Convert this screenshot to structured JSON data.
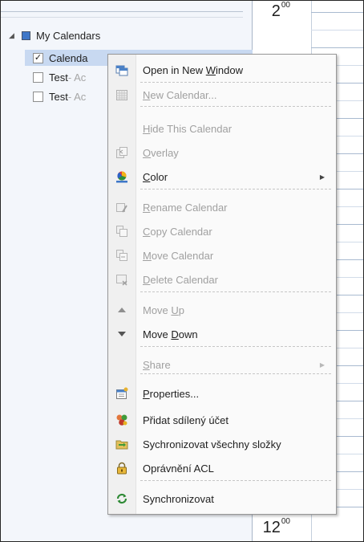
{
  "nav": {
    "group_label": "My Calendars",
    "calendars": [
      {
        "label": "Calenda",
        "suffix": "",
        "checked": true,
        "selected": true
      },
      {
        "label": "Test",
        "suffix": " - Ac",
        "checked": false,
        "selected": false
      },
      {
        "label": "Test",
        "suffix": " - Ac",
        "checked": false,
        "selected": false
      }
    ]
  },
  "dayview": {
    "top_hour": "2",
    "top_minutes": "00",
    "bottom_hour": "12",
    "bottom_minutes": "00"
  },
  "menu": {
    "items": [
      {
        "key": "open_new_window",
        "pre": "Open in New ",
        "ul": "W",
        "post": "indow",
        "disabled": false,
        "icon": "new-window-icon"
      },
      {
        "key": "new_calendar",
        "pre": "",
        "ul": "N",
        "post": "ew Calendar...",
        "disabled": true,
        "icon": "calendar-grid-icon"
      },
      {
        "key": "hide_calendar",
        "pre": "",
        "ul": "H",
        "post": "ide This Calendar",
        "disabled": true,
        "icon": ""
      },
      {
        "key": "overlay",
        "pre": "",
        "ul": "O",
        "post": "verlay",
        "disabled": true,
        "icon": "overlay-icon"
      },
      {
        "key": "color",
        "pre": "",
        "ul": "C",
        "post": "olor",
        "disabled": false,
        "icon": "color-palette-icon",
        "submenu": true
      },
      {
        "key": "rename",
        "pre": "",
        "ul": "R",
        "post": "ename Calendar",
        "disabled": true,
        "icon": "rename-icon"
      },
      {
        "key": "copy",
        "pre": "",
        "ul": "C",
        "post": "opy Calendar",
        "disabled": true,
        "icon": "copy-icon"
      },
      {
        "key": "move",
        "pre": "",
        "ul": "M",
        "post": "ove Calendar",
        "disabled": true,
        "icon": "move-icon"
      },
      {
        "key": "delete",
        "pre": "",
        "ul": "D",
        "post": "elete Calendar",
        "disabled": true,
        "icon": "delete-icon"
      },
      {
        "key": "move_up",
        "pre": "Move ",
        "ul": "U",
        "post": "p",
        "disabled": true,
        "icon": "arrow-up-icon"
      },
      {
        "key": "move_down",
        "pre": "Move ",
        "ul": "D",
        "post": "own",
        "disabled": false,
        "icon": "arrow-down-icon"
      },
      {
        "key": "share",
        "pre": "",
        "ul": "S",
        "post": "hare",
        "disabled": true,
        "icon": "",
        "submenu": true
      },
      {
        "key": "properties",
        "pre": "",
        "ul": "P",
        "post": "roperties...",
        "disabled": false,
        "icon": "properties-icon"
      },
      {
        "key": "add_shared",
        "pre": "Přidat sdílený účet",
        "ul": "",
        "post": "",
        "disabled": false,
        "icon": "shared-account-icon"
      },
      {
        "key": "sync_all",
        "pre": "Sychronizovat všechny složky",
        "ul": "",
        "post": "",
        "disabled": false,
        "icon": "sync-folders-icon"
      },
      {
        "key": "acl",
        "pre": "Oprávnění ACL",
        "ul": "",
        "post": "",
        "disabled": false,
        "icon": "lock-icon"
      },
      {
        "key": "sync",
        "pre": "Synchronizovat",
        "ul": "",
        "post": "",
        "disabled": false,
        "icon": "sync-icon"
      }
    ],
    "submenu_arrow": "▶"
  },
  "colors": {
    "selected_row": "#c8d9f1",
    "calendar_blue": "#3e77c8",
    "disabled_text": "#a0a0a0"
  }
}
